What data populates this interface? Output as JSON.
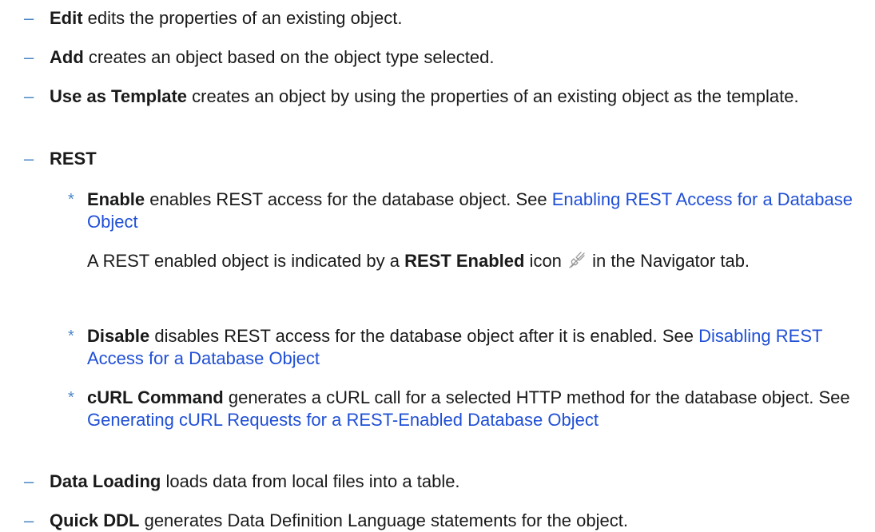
{
  "markers": {
    "dash": "–",
    "star": "*"
  },
  "items": [
    {
      "term": "Edit",
      "desc": " edits the properties of an existing object."
    },
    {
      "term": "Add",
      "desc": " creates an object based on the object type selected."
    },
    {
      "term": "Use as Template",
      "desc": " creates an object by using the properties of an existing object as the template."
    },
    {
      "term": "REST",
      "desc": ""
    },
    {
      "term": "Data Loading",
      "desc": " loads data from local files into a table."
    },
    {
      "term": "Quick DDL",
      "desc": " generates Data Definition Language statements for the object."
    }
  ],
  "rest": {
    "enable": {
      "term": "Enable",
      "desc": " enables REST access for the database object. See ",
      "link": "Enabling REST Access for a Database Object"
    },
    "enabled_note": {
      "before": "A REST enabled object is indicated by a ",
      "term": "REST Enabled",
      "middle": " icon ",
      "after": " in the Navigator tab."
    },
    "disable": {
      "term": "Disable",
      "desc": " disables REST access for the database object after it is enabled. See ",
      "link": "Disabling REST Access for a Database Object"
    },
    "curl": {
      "term": "cURL Command",
      "desc": " generates a cURL call for a selected HTTP method for the database object. See ",
      "link": "Generating cURL Requests for a REST-Enabled Database Object"
    }
  },
  "colors": {
    "marker": "#4a86c8",
    "link": "#1f4fd6",
    "text": "#1a1a1a"
  },
  "icons": {
    "rest_enabled": "plug-icon"
  }
}
